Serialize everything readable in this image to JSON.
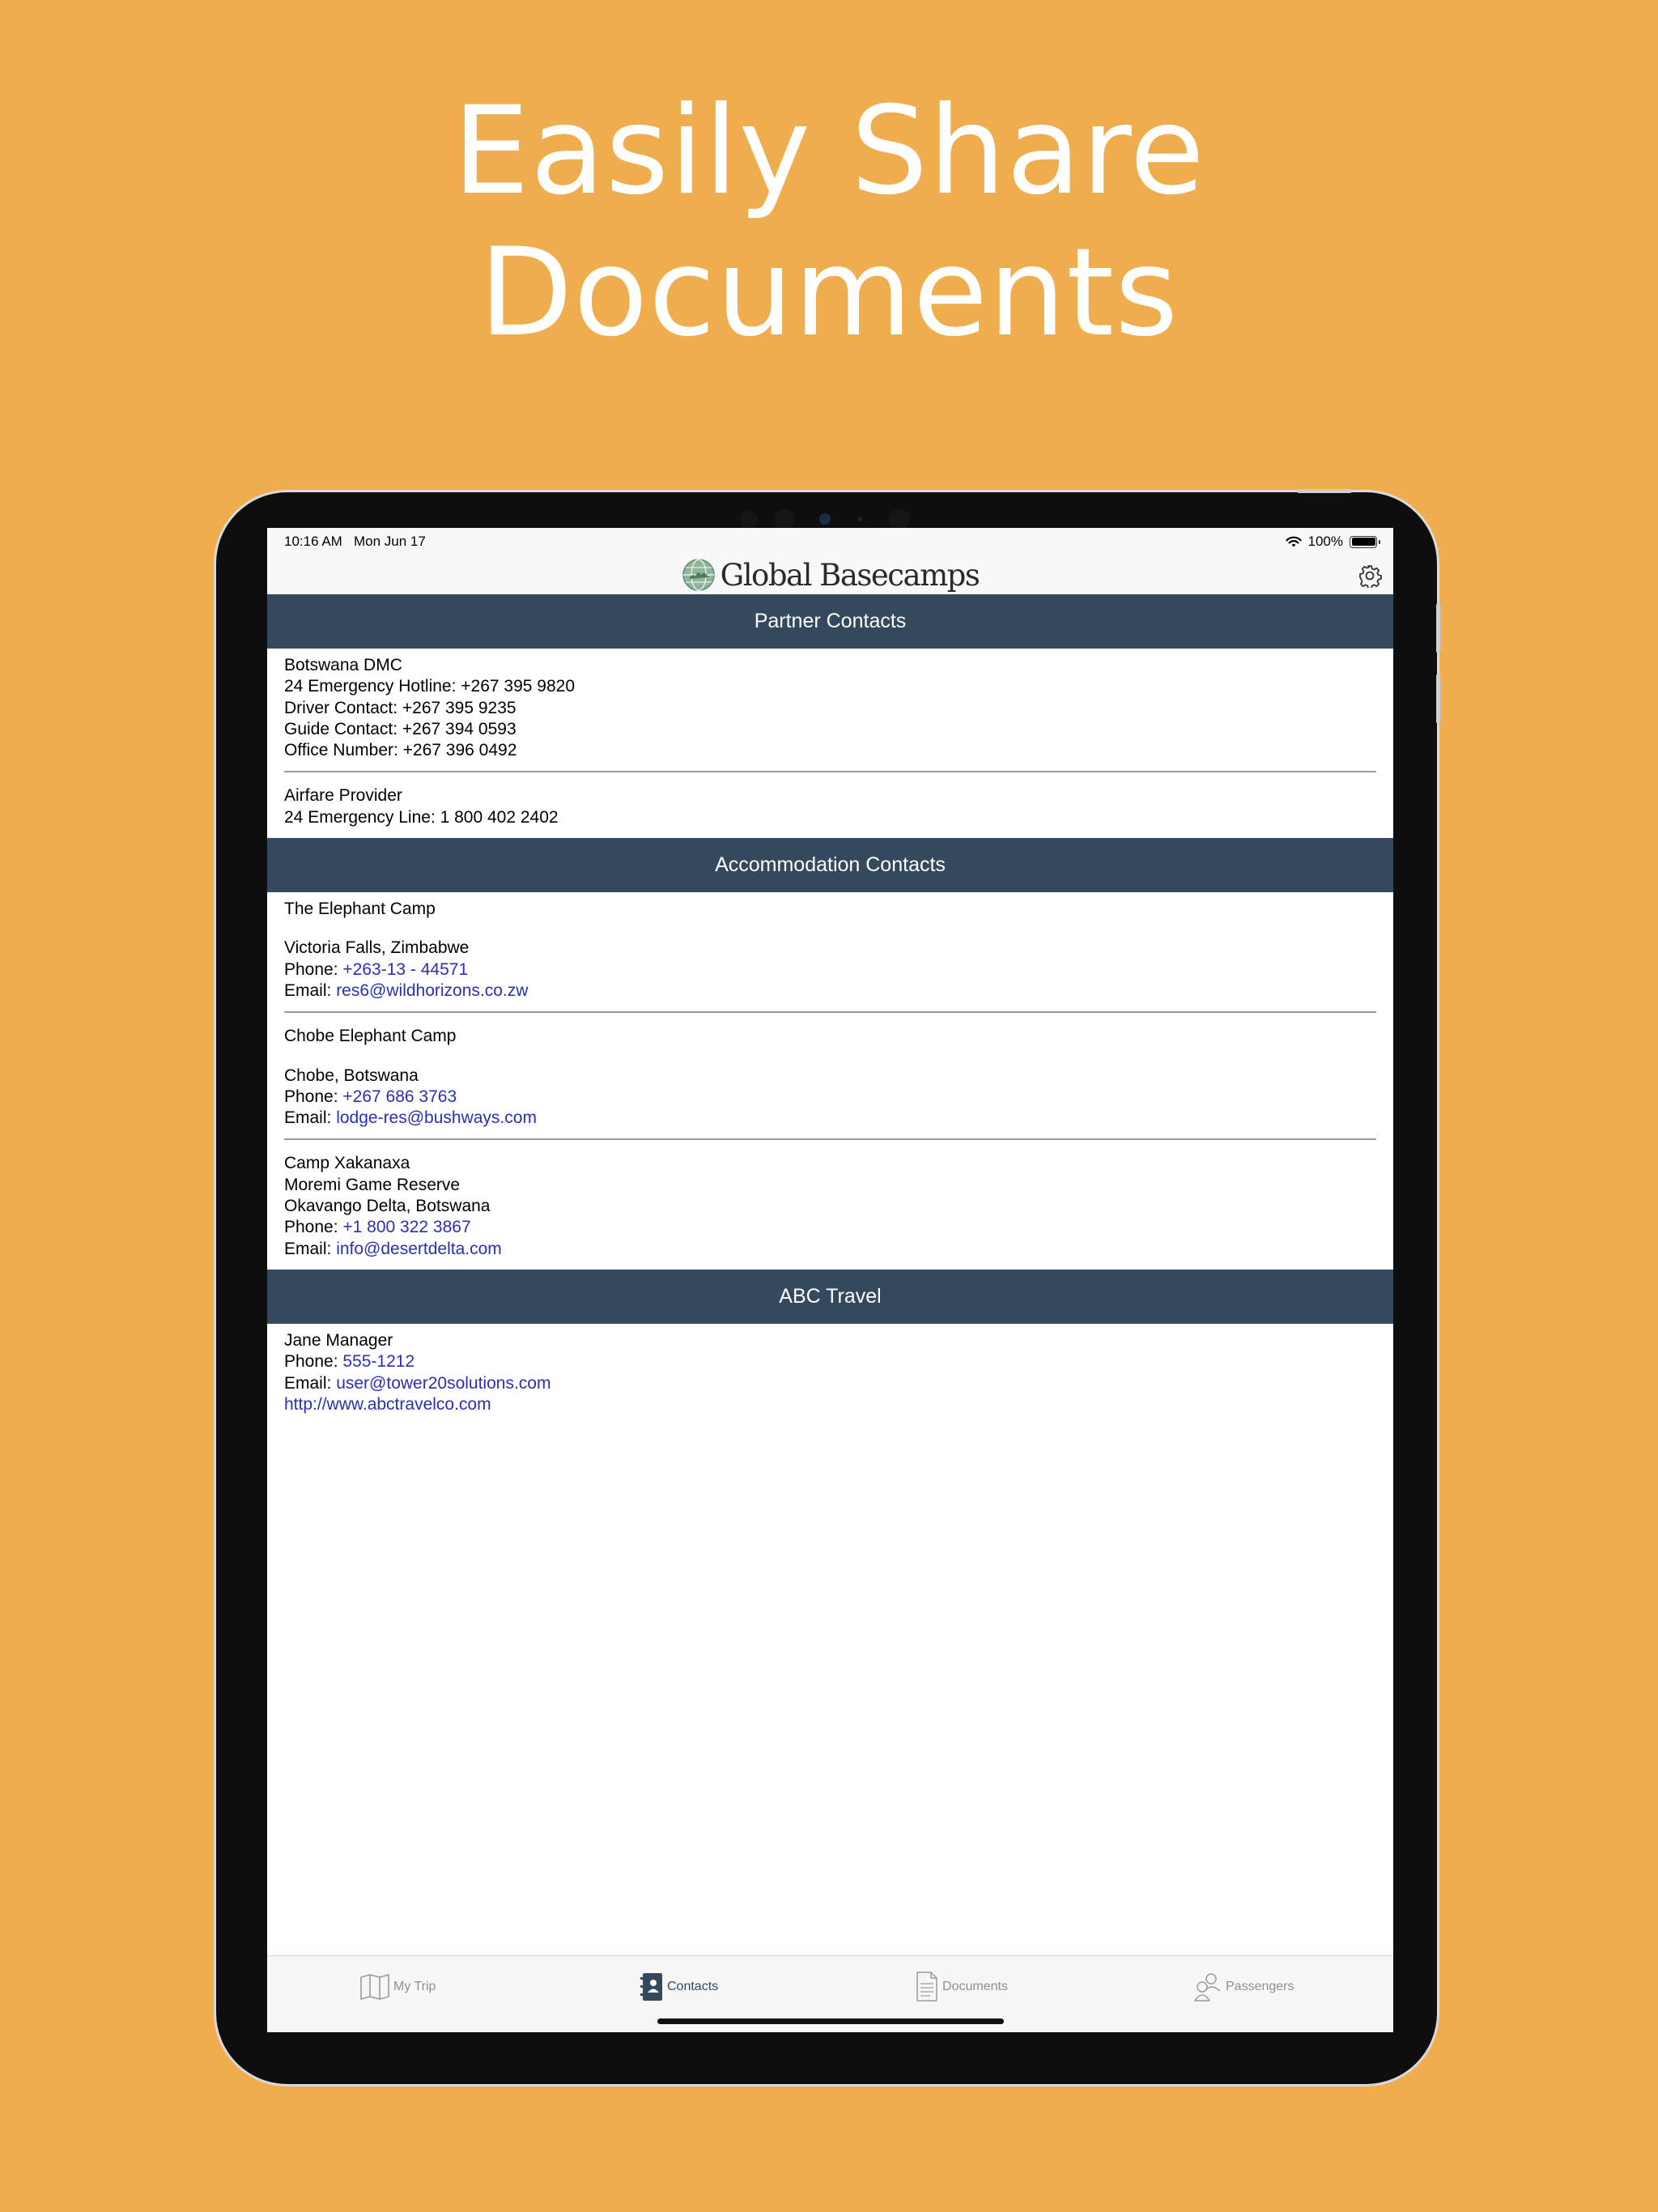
{
  "headline": {
    "line1": "Easily Share",
    "line2": "Documents"
  },
  "status_bar": {
    "time": "10:16 AM",
    "date": "Mon Jun 17",
    "battery": "100%"
  },
  "app": {
    "brand": "Global Basecamps",
    "settings_icon": "gear-icon"
  },
  "sections": {
    "partner": {
      "title": "Partner Contacts",
      "contacts": [
        {
          "lines": [
            "Botswana DMC",
            "24 Emergency Hotline: +267 395 9820",
            "Driver Contact: +267 395 9235",
            "Guide Contact: +267 394 0593",
            "Office Number: +267 396 0492"
          ]
        },
        {
          "lines": [
            "Airfare Provider",
            "24 Emergency Line: 1 800 402 2402"
          ]
        }
      ]
    },
    "accommodation": {
      "title": "Accommodation Contacts",
      "contacts": [
        {
          "name": "The Elephant Camp",
          "location": "Victoria Falls, Zimbabwe",
          "phone_label": "Phone: ",
          "phone": "+263-13 - 44571",
          "email_label": "Email: ",
          "email": "res6@wildhorizons.co.zw"
        },
        {
          "name": "Chobe Elephant Camp",
          "location": "Chobe, Botswana",
          "phone_label": "Phone: ",
          "phone": "+267 686 3763",
          "email_label": "Email: ",
          "email": "lodge-res@bushways.com"
        },
        {
          "name": "Camp Xakanaxa",
          "location1": "Moremi Game Reserve",
          "location2": "Okavango Delta, Botswana",
          "phone_label": "Phone: ",
          "phone": "+1 800 322 3867",
          "email_label": "Email: ",
          "email": "info@desertdelta.com"
        }
      ]
    },
    "agency": {
      "title": "ABC Travel",
      "contact": {
        "name": "Jane Manager",
        "phone_label": "Phone: ",
        "phone": "555-1212",
        "email_label": "Email: ",
        "email": "user@tower20solutions.com",
        "website": "http://www.abctravelco.com"
      }
    }
  },
  "tabs": [
    {
      "label": "My Trip",
      "icon": "map-icon",
      "active": false
    },
    {
      "label": "Contacts",
      "icon": "contacts-book-icon",
      "active": true
    },
    {
      "label": "Documents",
      "icon": "document-icon",
      "active": false
    },
    {
      "label": "Passengers",
      "icon": "passengers-icon",
      "active": false
    }
  ],
  "colors": {
    "background": "#f0ad4e",
    "section_header": "#34495e",
    "link": "#2b2fb5"
  }
}
